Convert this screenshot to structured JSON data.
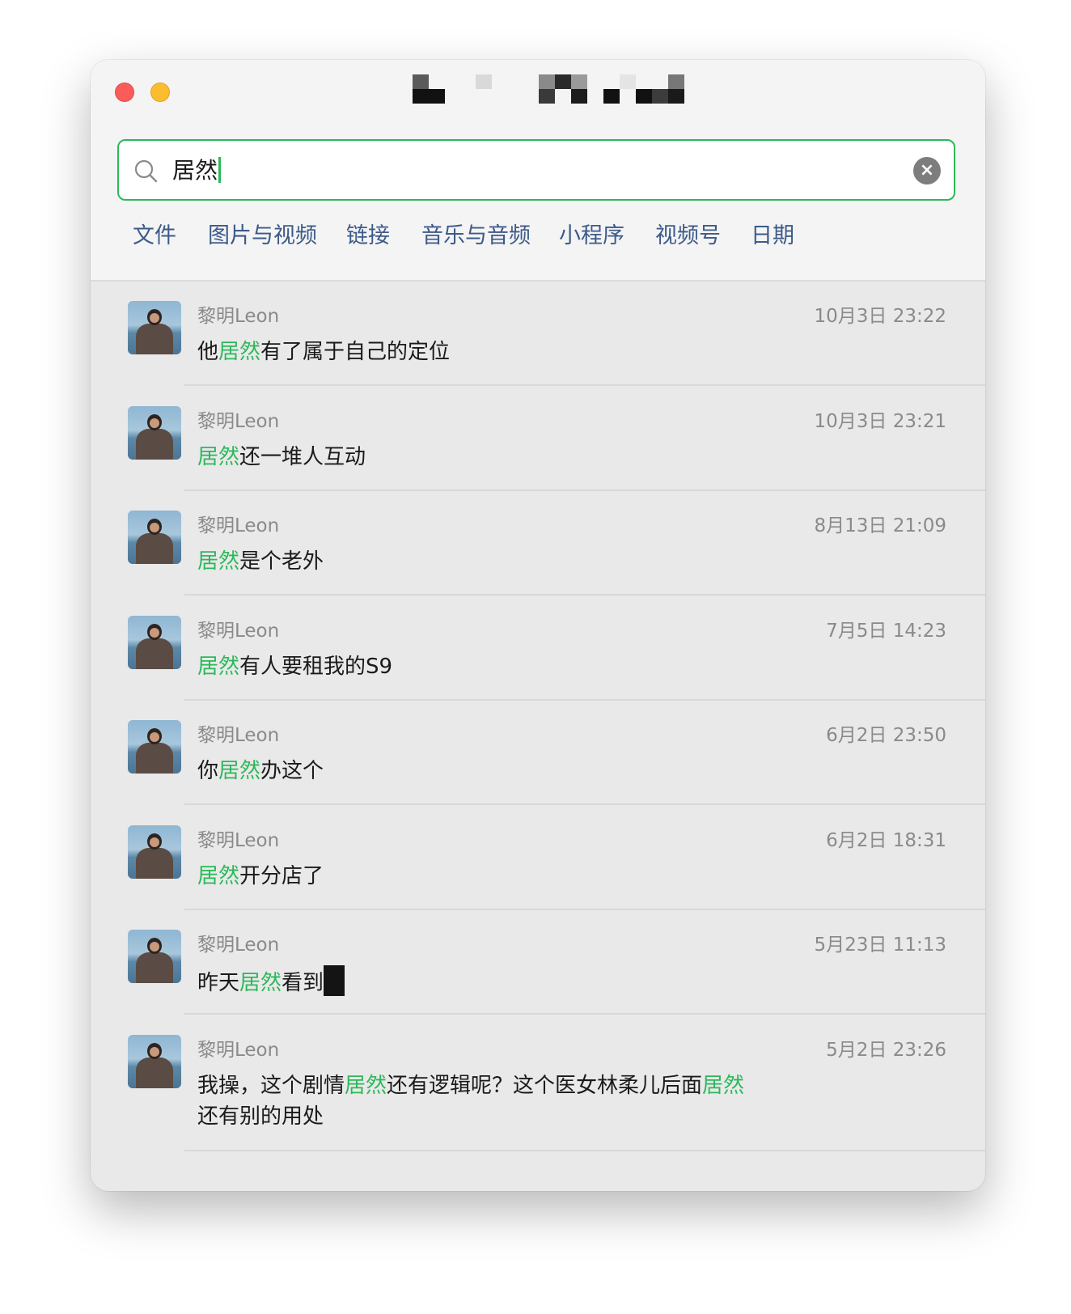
{
  "window": {
    "controls": [
      "close",
      "minimize"
    ]
  },
  "search": {
    "query": "居然",
    "icon": "search-icon",
    "clear_icon": "clear-icon"
  },
  "filters": [
    "文件",
    "图片与视频",
    "链接",
    "音乐与音频",
    "小程序",
    "视频号",
    "日期"
  ],
  "results": [
    {
      "sender": "黎明Leon",
      "time": "10月3日 23:22",
      "message": [
        {
          "t": "他"
        },
        {
          "t": "居然",
          "hl": true
        },
        {
          "t": "有了属于自己的定位"
        }
      ]
    },
    {
      "sender": "黎明Leon",
      "time": "10月3日 23:21",
      "message": [
        {
          "t": "居然",
          "hl": true
        },
        {
          "t": "还一堆人互动"
        }
      ]
    },
    {
      "sender": "黎明Leon",
      "time": "8月13日 21:09",
      "message": [
        {
          "t": "居然",
          "hl": true
        },
        {
          "t": "是个老外"
        }
      ]
    },
    {
      "sender": "黎明Leon",
      "time": "7月5日 14:23",
      "message": [
        {
          "t": "居然",
          "hl": true
        },
        {
          "t": "有人要租我的S9"
        }
      ]
    },
    {
      "sender": "黎明Leon",
      "time": "6月2日 23:50",
      "message": [
        {
          "t": "你"
        },
        {
          "t": "居然",
          "hl": true
        },
        {
          "t": "办这个"
        }
      ]
    },
    {
      "sender": "黎明Leon",
      "time": "6月2日 18:31",
      "message": [
        {
          "t": "居然",
          "hl": true
        },
        {
          "t": "开分店了"
        }
      ]
    },
    {
      "sender": "黎明Leon",
      "time": "5月23日 11:13",
      "message": [
        {
          "t": "昨天"
        },
        {
          "t": "居然",
          "hl": true
        },
        {
          "t": "看到"
        },
        {
          "redacted": true
        }
      ]
    },
    {
      "sender": "黎明Leon",
      "time": "5月2日 23:26",
      "message": [
        {
          "t": "我操，这个剧情"
        },
        {
          "t": "居然",
          "hl": true
        },
        {
          "t": "还有逻辑呢？这个医女林柔儿后面"
        },
        {
          "t": "居然",
          "hl": true
        },
        {
          "t": "还有别的用处"
        }
      ]
    }
  ],
  "colors": {
    "accent": "#2cb85a",
    "filter_text": "#3d5a89",
    "meta_text": "#8a8a8a"
  }
}
